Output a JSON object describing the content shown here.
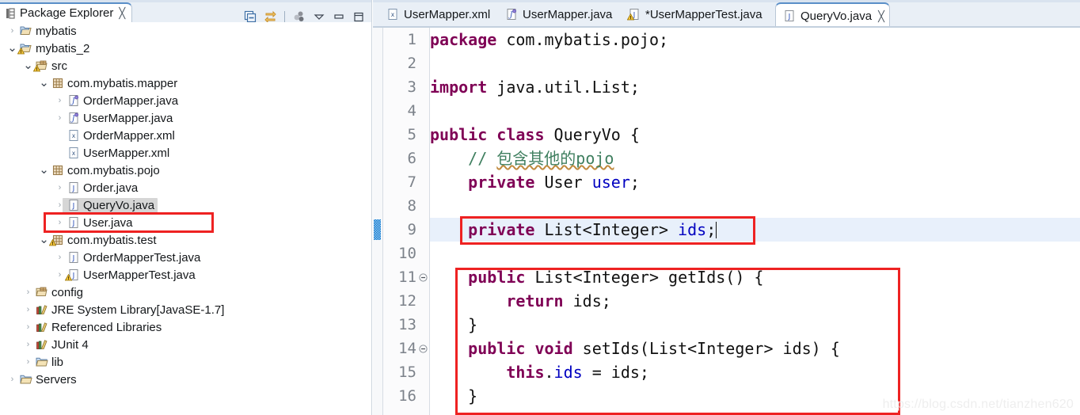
{
  "explorer": {
    "view_tab": {
      "label": "Package Explorer",
      "icon": "package-explorer-icon",
      "close": "╳"
    },
    "toolbar": [
      {
        "name": "collapse-all-icon",
        "title": "Collapse All"
      },
      {
        "name": "link-with-editor-icon",
        "title": "Link with Editor"
      },
      {
        "name": "focus-on-active-task-icon",
        "title": "Focus"
      },
      {
        "name": "view-menu-icon",
        "title": "View Menu"
      },
      {
        "name": "minimize-icon",
        "title": "Minimize"
      },
      {
        "name": "maximize-icon",
        "title": "Maximize"
      }
    ],
    "tree": [
      {
        "label": "mybatis",
        "icon": "project-icon",
        "indent": 0,
        "arrow": "collapsed",
        "warn": false,
        "selected": false
      },
      {
        "label": "mybatis_2",
        "icon": "project-icon",
        "indent": 0,
        "arrow": "expanded",
        "warn": true,
        "selected": false
      },
      {
        "label": "src",
        "icon": "source-folder-icon",
        "indent": 1,
        "arrow": "expanded",
        "warn": true,
        "selected": false
      },
      {
        "label": "com.mybatis.mapper",
        "icon": "package-icon",
        "indent": 2,
        "arrow": "expanded",
        "warn": false,
        "selected": false
      },
      {
        "label": "OrderMapper.java",
        "icon": "java-interface-icon",
        "indent": 3,
        "arrow": "collapsed",
        "warn": false,
        "selected": false
      },
      {
        "label": "UserMapper.java",
        "icon": "java-interface-icon",
        "indent": 3,
        "arrow": "collapsed",
        "warn": false,
        "selected": false
      },
      {
        "label": "OrderMapper.xml",
        "icon": "xml-file-icon",
        "indent": 3,
        "arrow": "none",
        "warn": false,
        "selected": false
      },
      {
        "label": "UserMapper.xml",
        "icon": "xml-file-icon",
        "indent": 3,
        "arrow": "none",
        "warn": false,
        "selected": false
      },
      {
        "label": "com.mybatis.pojo",
        "icon": "package-icon",
        "indent": 2,
        "arrow": "expanded",
        "warn": false,
        "selected": false
      },
      {
        "label": "Order.java",
        "icon": "java-class-icon",
        "indent": 3,
        "arrow": "collapsed",
        "warn": false,
        "selected": false
      },
      {
        "label": "QueryVo.java",
        "icon": "java-class-icon",
        "indent": 3,
        "arrow": "collapsed",
        "warn": false,
        "selected": true
      },
      {
        "label": "User.java",
        "icon": "java-class-icon",
        "indent": 3,
        "arrow": "collapsed",
        "warn": false,
        "selected": false
      },
      {
        "label": "com.mybatis.test",
        "icon": "package-icon",
        "indent": 2,
        "arrow": "expanded",
        "warn": true,
        "selected": false
      },
      {
        "label": "OrderMapperTest.java",
        "icon": "java-class-icon",
        "indent": 3,
        "arrow": "collapsed",
        "warn": false,
        "selected": false
      },
      {
        "label": "UserMapperTest.java",
        "icon": "java-class-icon",
        "indent": 3,
        "arrow": "collapsed",
        "warn": true,
        "selected": false
      },
      {
        "label": "config",
        "icon": "source-folder-icon",
        "indent": 1,
        "arrow": "collapsed",
        "warn": false,
        "selected": false
      },
      {
        "label": "JRE System Library ",
        "dim": "[JavaSE-1.7]",
        "icon": "library-icon",
        "indent": 1,
        "arrow": "collapsed",
        "warn": false,
        "selected": false
      },
      {
        "label": "Referenced Libraries",
        "icon": "library-icon",
        "indent": 1,
        "arrow": "collapsed",
        "warn": false,
        "selected": false
      },
      {
        "label": "JUnit 4",
        "icon": "library-icon",
        "indent": 1,
        "arrow": "collapsed",
        "warn": false,
        "selected": false
      },
      {
        "label": "lib",
        "icon": "folder-icon",
        "indent": 1,
        "arrow": "collapsed",
        "warn": false,
        "selected": false
      },
      {
        "label": "Servers",
        "icon": "folder-icon",
        "indent": 0,
        "arrow": "collapsed",
        "warn": false,
        "selected": false
      }
    ]
  },
  "editor": {
    "tabs": [
      {
        "label": "UserMapper.xml",
        "icon": "xml-file-icon",
        "active": false,
        "dirty": false,
        "warn": false
      },
      {
        "label": "UserMapper.java",
        "icon": "java-interface-icon",
        "active": false,
        "dirty": false,
        "warn": false
      },
      {
        "label": "*UserMapperTest.java",
        "icon": "java-class-icon",
        "active": false,
        "dirty": true,
        "warn": true
      },
      {
        "label": "QueryVo.java",
        "icon": "java-class-icon",
        "active": true,
        "dirty": false,
        "warn": false,
        "close": "╳"
      }
    ],
    "lines": [
      {
        "n": "1",
        "fold": false,
        "current": false,
        "changed": false
      },
      {
        "n": "2",
        "fold": false,
        "current": false,
        "changed": false
      },
      {
        "n": "3",
        "fold": false,
        "current": false,
        "changed": false
      },
      {
        "n": "4",
        "fold": false,
        "current": false,
        "changed": false
      },
      {
        "n": "5",
        "fold": false,
        "current": false,
        "changed": false
      },
      {
        "n": "6",
        "fold": false,
        "current": false,
        "changed": false
      },
      {
        "n": "7",
        "fold": false,
        "current": false,
        "changed": false
      },
      {
        "n": "8",
        "fold": false,
        "current": false,
        "changed": false
      },
      {
        "n": "9",
        "fold": false,
        "current": true,
        "changed": true
      },
      {
        "n": "10",
        "fold": false,
        "current": false,
        "changed": false
      },
      {
        "n": "11",
        "fold": true,
        "current": false,
        "changed": false
      },
      {
        "n": "12",
        "fold": false,
        "current": false,
        "changed": false
      },
      {
        "n": "13",
        "fold": false,
        "current": false,
        "changed": false
      },
      {
        "n": "14",
        "fold": true,
        "current": false,
        "changed": false
      },
      {
        "n": "15",
        "fold": false,
        "current": false,
        "changed": false
      },
      {
        "n": "16",
        "fold": false,
        "current": false,
        "changed": false
      }
    ],
    "code_plain": [
      "package com.mybatis.pojo;",
      "",
      "import java.util.List;",
      "",
      "public class QueryVo {",
      "    // 包含其他的pojo",
      "    private User user;",
      "",
      "    private List<Integer> ids;",
      "",
      "    public List<Integer> getIds() {",
      "        return ids;",
      "    }",
      "    public void setIds(List<Integer> ids) {",
      "        this.ids = ids;",
      "    }"
    ]
  },
  "watermark": "https://blog.csdn.net/tianzhen620",
  "colors": {
    "keyword": "#7f0055",
    "field": "#0000c0",
    "comment": "#3f7f5f",
    "annotation_box": "#ee2222",
    "current_line": "#e8f0fb",
    "selection": "#d6d6d6",
    "tab_bar": "#e9eff6",
    "tab_accent": "#5a8fc8"
  }
}
